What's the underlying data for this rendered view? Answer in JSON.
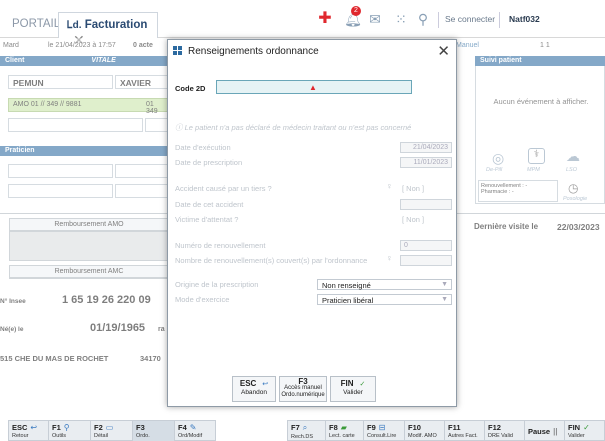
{
  "topbar": {
    "tab_portail": "PORTAIL",
    "tab_facturation": "Facturation",
    "notif_count": "2",
    "connect_label": "Se connecter",
    "user_label": "Natf032"
  },
  "background": {
    "row_user": "Mard",
    "row_date": "le 21/04/2023 à 17:57",
    "row_acts": "0 acte",
    "row_manuel": "Manuel",
    "row_count": "1 1",
    "client_header": "Client",
    "vitale_header": "VITALE",
    "last_name": "PEMUN",
    "first_name": "XAVIER",
    "amo_line": "AMO 01 // 349 // 9881",
    "amo_line_right": "01 349",
    "praticien_header": "Praticien",
    "suivi_header": "Suivi patient",
    "suivi_empty": "Aucun événement à afficher.",
    "dmp_labels": [
      "De-Pill",
      "MPM",
      "LSO"
    ],
    "renouvellement_label": "Renouvellement :",
    "renouvellement_value": "-",
    "pharmacie_label": "Pharmacie :",
    "pharmacie_value": "-",
    "posologie_label": "Posologie",
    "remb_amo": "Remboursement AMO",
    "remb_amc": "Remboursement AMC",
    "derniere_visite_label": "Dernière visite le",
    "derniere_visite_date": "22/03/2023",
    "insee_label": "N° Insee",
    "insee_value": "1 65 19 26 220 09",
    "birth_label": "Né(e) le",
    "birth_value": "01/19/1965",
    "birth_suffix": "ra",
    "address": "515 CHE DU MAS DE ROCHET",
    "address_cp": "34170"
  },
  "modal": {
    "title": "Renseignements ordonnance",
    "code2d_label": "Code 2D",
    "warning_text": "Le patient n'a pas déclaré de médecin traitant ou n'est pas concerné",
    "date_execution_label": "Date d'exécution",
    "date_execution_value": "21/04/2023",
    "date_prescription_label": "Date de prescription",
    "date_prescription_value": "11/01/2023",
    "accident_label": "Accident causé par un tiers ?",
    "accident_value": "[ Non ]",
    "date_accident_label": "Date de cet accident",
    "victime_label": "Victime d'attentat ?",
    "victime_value": "[ Non ]",
    "num_renouv_label": "Numéro de renouvellement",
    "num_renouv_value": "0",
    "nb_renouv_label": "Nombre de renouvellement(s) couvert(s) par l'ordonnance",
    "origine_label": "Origine de la prescription",
    "origine_value": "Non renseigné",
    "mode_label": "Mode d'exercice",
    "mode_value": "Praticien libéral",
    "buttons": [
      {
        "key": "ESC",
        "label": "Abandon"
      },
      {
        "key": "F3",
        "label1": "Accès manuel",
        "label2": "Ordo.numérique"
      },
      {
        "key": "FIN",
        "label": "Valider"
      }
    ]
  },
  "fbar": {
    "keys": [
      {
        "k": "ESC",
        "l": "Retour"
      },
      {
        "k": "F1",
        "l": "Outils"
      },
      {
        "k": "F2",
        "l": "Détail"
      },
      {
        "k": "F3",
        "l": "Ordo."
      },
      {
        "k": "F4",
        "l": "Ord/Modif"
      }
    ],
    "keys_right": [
      {
        "k": "F7",
        "l": "Rech.DS"
      },
      {
        "k": "F8",
        "l": "Lect. carte"
      },
      {
        "k": "F9",
        "l": "Consult.Lire"
      },
      {
        "k": "F10",
        "l": "Modif. AMO"
      },
      {
        "k": "F11",
        "l": "Autres Fact."
      },
      {
        "k": "F12",
        "l": "DRE Valid"
      },
      {
        "k": "Pause",
        "l": ""
      },
      {
        "k": "FIN",
        "l": "Valider"
      }
    ]
  },
  "colors": {
    "accent": "#2c6aa0",
    "notif_red": "#e0282e",
    "modal_highlight": "#e6f3f5"
  }
}
